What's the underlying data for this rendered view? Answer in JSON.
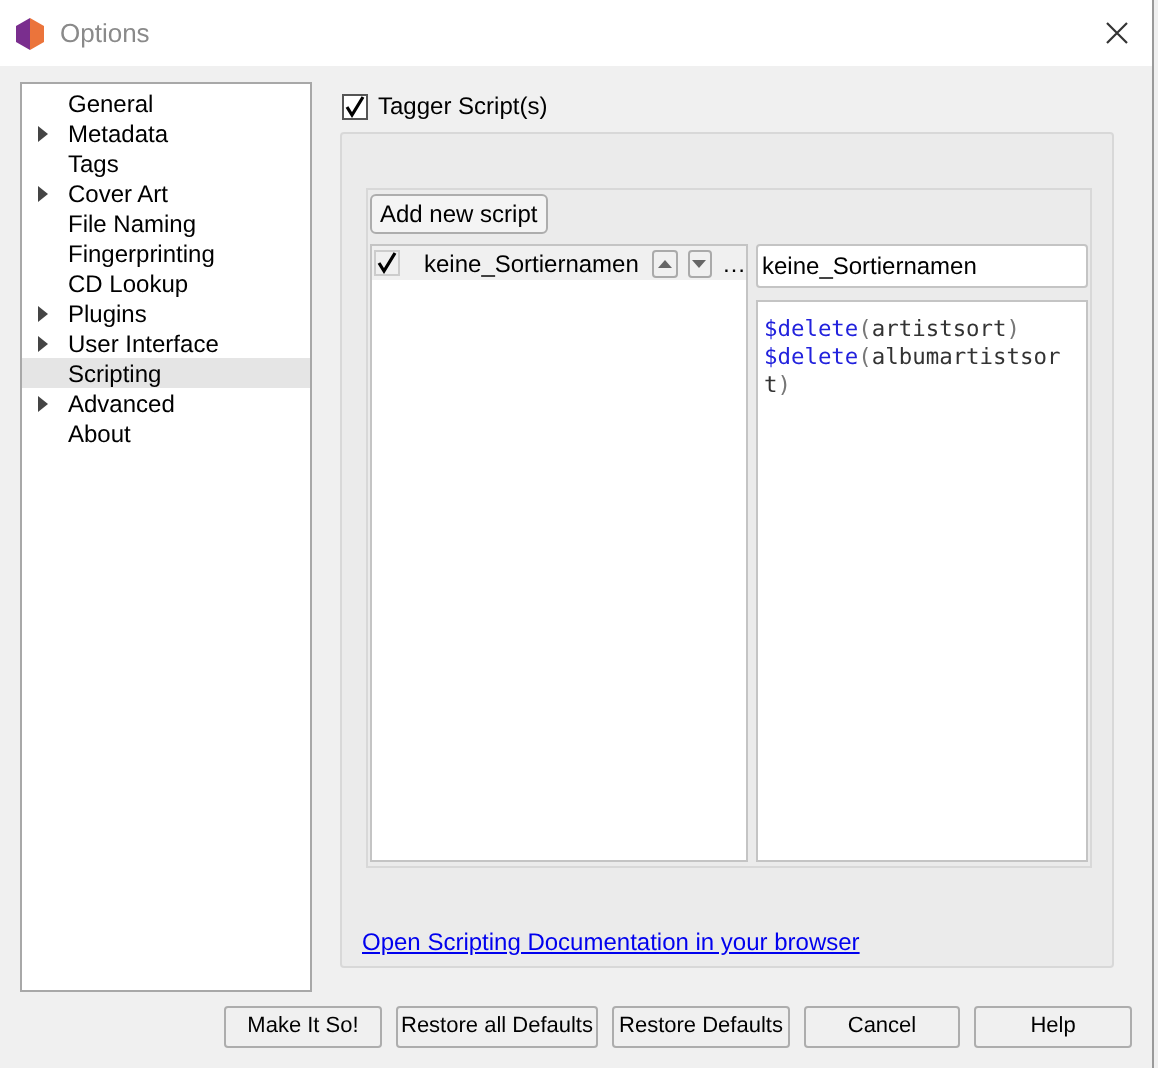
{
  "window": {
    "title": "Options"
  },
  "sidebar": {
    "items": [
      {
        "label": "General",
        "has_children": false,
        "selected": false
      },
      {
        "label": "Metadata",
        "has_children": true,
        "selected": false
      },
      {
        "label": "Tags",
        "has_children": false,
        "selected": false
      },
      {
        "label": "Cover Art",
        "has_children": true,
        "selected": false
      },
      {
        "label": "File Naming",
        "has_children": false,
        "selected": false
      },
      {
        "label": "Fingerprinting",
        "has_children": false,
        "selected": false
      },
      {
        "label": "CD Lookup",
        "has_children": false,
        "selected": false
      },
      {
        "label": "Plugins",
        "has_children": true,
        "selected": false
      },
      {
        "label": "User Interface",
        "has_children": true,
        "selected": false
      },
      {
        "label": "Scripting",
        "has_children": false,
        "selected": true
      },
      {
        "label": "Advanced",
        "has_children": true,
        "selected": false
      },
      {
        "label": "About",
        "has_children": false,
        "selected": false
      }
    ]
  },
  "tagger_scripts": {
    "label": "Tagger Script(s)",
    "checked": true,
    "add_button": "Add new script",
    "scripts": [
      {
        "name": "keine_Sortiernamen",
        "enabled": true,
        "selected": true,
        "more": "…"
      }
    ],
    "name_field": "keine_Sortiernamen",
    "editor_lines": [
      [
        {
          "kind": "function",
          "text": "$delete"
        },
        {
          "kind": "paren",
          "text": "("
        },
        {
          "kind": "text",
          "text": "artistsort"
        },
        {
          "kind": "paren",
          "text": ")"
        }
      ],
      [
        {
          "kind": "function",
          "text": "$delete"
        },
        {
          "kind": "paren",
          "text": "("
        },
        {
          "kind": "text",
          "text": "albumartistsor"
        }
      ],
      [
        {
          "kind": "text",
          "text": "t"
        },
        {
          "kind": "paren",
          "text": ")"
        }
      ]
    ],
    "doc_link": "Open Scripting Documentation in your browser"
  },
  "buttons": [
    "Make It So!",
    "Restore all Defaults",
    "Restore Defaults",
    "Cancel",
    "Help"
  ]
}
